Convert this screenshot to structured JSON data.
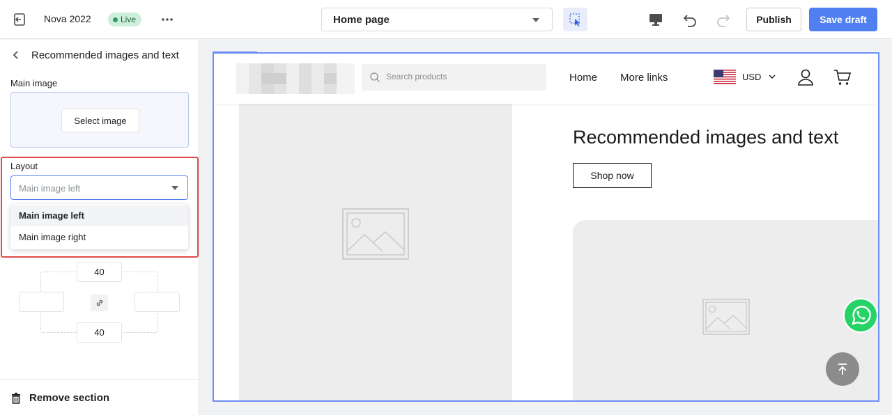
{
  "topbar": {
    "store_name": "Nova 2022",
    "live_badge": "Live",
    "page_selector": "Home page",
    "publish_label": "Publish",
    "save_draft_label": "Save draft",
    "icons": [
      "exit-icon",
      "more-icon",
      "caret-down-icon",
      "select-element-icon",
      "desktop-icon",
      "undo-icon",
      "redo-icon"
    ]
  },
  "sidebar": {
    "title": "Recommended images and text",
    "main_image_label": "Main image",
    "select_image_label": "Select image",
    "layout_label": "Layout",
    "layout_value": "Main image left",
    "layout_options": [
      "Main image left",
      "Main image right"
    ],
    "padding_top": "40",
    "padding_bottom": "40",
    "remove_section_label": "Remove section",
    "highlight_color": "#e04b4b"
  },
  "preview": {
    "search_placeholder": "Search products",
    "nav": [
      "Home",
      "More links"
    ],
    "currency": "USD",
    "section_title": "Recommended images and text",
    "shop_button": "Shop now"
  },
  "colors": {
    "accent": "#4f7ff0",
    "live_bg": "#cdeedb",
    "whatsapp": "#25d366"
  }
}
